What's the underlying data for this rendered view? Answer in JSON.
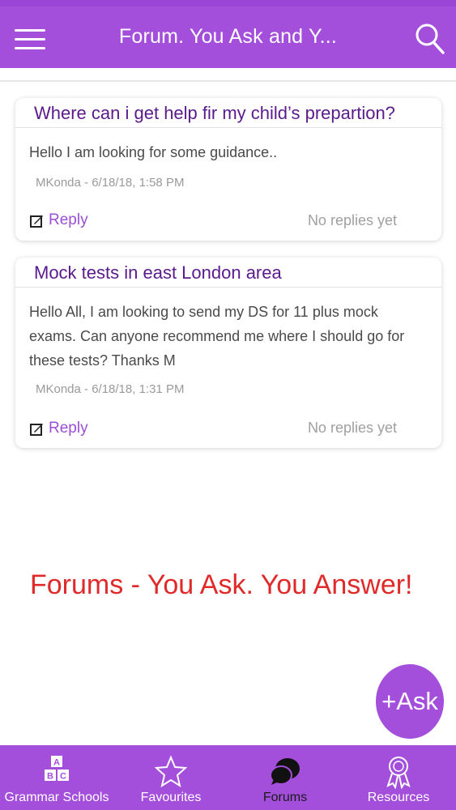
{
  "header": {
    "title": "Forum. You Ask and Y...",
    "menu_icon": "hamburger-menu-icon",
    "search_icon": "search-icon",
    "bg_color": "#a44fdc"
  },
  "posts": [
    {
      "title": "Where can i get help fir my child’s prepartion?",
      "body": "Hello I am looking for some guidance..",
      "meta": "MKonda - 6/18/18, 1:58 PM",
      "reply_label": "Reply",
      "reply_count": "No replies yet"
    },
    {
      "title": "Mock tests in east London area",
      "body": "Hello All, I am looking to send my DS for 11 plus mock exams. Can anyone recommend me where I should go for these tests? Thanks M",
      "meta": "MKonda - 6/18/18, 1:31 PM",
      "reply_label": "Reply",
      "reply_count": "No replies yet"
    }
  ],
  "promo": {
    "text": "Forums - You Ask. You Answer!",
    "color": "#e02a2a"
  },
  "fab": {
    "label": "+Ask"
  },
  "tabs": [
    {
      "label": "Grammar Schools",
      "icon": "abc-blocks-icon",
      "active": false
    },
    {
      "label": "Favourites",
      "icon": "star-icon",
      "active": false
    },
    {
      "label": "Forums",
      "icon": "chat-bubbles-icon",
      "active": true
    },
    {
      "label": "Resources",
      "icon": "award-ribbon-icon",
      "active": false
    }
  ]
}
